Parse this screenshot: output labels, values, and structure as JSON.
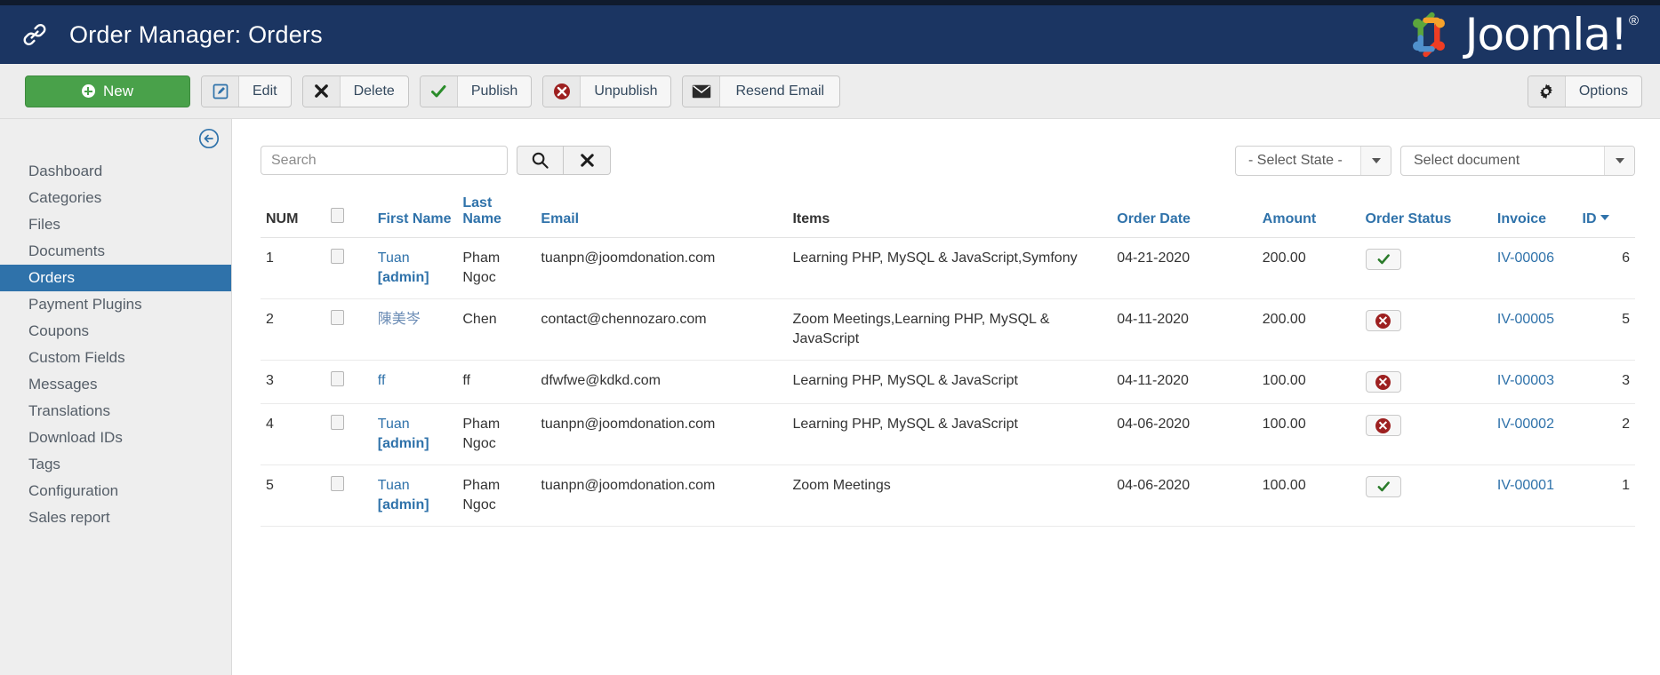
{
  "header": {
    "title": "Order Manager: Orders",
    "link_icon": "link-icon",
    "brand_name": "Joomla!",
    "brand_reg": "®",
    "bg_color": "#1b3562"
  },
  "toolbar": {
    "new_label": "New",
    "edit_label": "Edit",
    "delete_label": "Delete",
    "publish_label": "Publish",
    "unpublish_label": "Unpublish",
    "resend_label": "Resend Email",
    "options_label": "Options",
    "new_color": "#49a14a"
  },
  "sidebar": {
    "collapse_icon": "collapse-left-icon",
    "items": [
      {
        "label": "Dashboard",
        "active": false
      },
      {
        "label": "Categories",
        "active": false
      },
      {
        "label": "Files",
        "active": false
      },
      {
        "label": "Documents",
        "active": false
      },
      {
        "label": "Orders",
        "active": true
      },
      {
        "label": "Payment Plugins",
        "active": false
      },
      {
        "label": "Coupons",
        "active": false
      },
      {
        "label": "Custom Fields",
        "active": false
      },
      {
        "label": "Messages",
        "active": false
      },
      {
        "label": "Translations",
        "active": false
      },
      {
        "label": "Download IDs",
        "active": false
      },
      {
        "label": "Tags",
        "active": false
      },
      {
        "label": "Configuration",
        "active": false
      },
      {
        "label": "Sales report",
        "active": false
      }
    ],
    "active_color": "#2f72aa"
  },
  "filters": {
    "search_value": "",
    "search_placeholder": "Search",
    "search_button_icon": "search-icon",
    "clear_button_icon": "clear-x-icon",
    "state_select": "- Select State -",
    "document_select": "Select document"
  },
  "table": {
    "columns": [
      {
        "key": "num",
        "label": "NUM",
        "sortable": false
      },
      {
        "key": "check",
        "label": "",
        "sortable": false
      },
      {
        "key": "first_name",
        "label": "First Name",
        "sortable": true
      },
      {
        "key": "last_name",
        "label": "Last Name",
        "sortable": true
      },
      {
        "key": "email",
        "label": "Email",
        "sortable": true
      },
      {
        "key": "items",
        "label": "Items",
        "sortable": false
      },
      {
        "key": "order_date",
        "label": "Order Date",
        "sortable": true
      },
      {
        "key": "amount",
        "label": "Amount",
        "sortable": true
      },
      {
        "key": "order_status",
        "label": "Order Status",
        "sortable": true
      },
      {
        "key": "invoice",
        "label": "Invoice",
        "sortable": false
      },
      {
        "key": "id",
        "label": "ID",
        "sortable": true,
        "sort_active": true
      }
    ],
    "rows": [
      {
        "num": "1",
        "first_name": "Tuan",
        "first_name_tag": "[admin]",
        "last_name": "Pham Ngoc",
        "email": "tuanpn@joomdonation.com",
        "items": "Learning PHP, MySQL & JavaScript,Symfony",
        "order_date": "04-21-2020",
        "amount": "200.00",
        "order_status": "published",
        "invoice": "IV-00006",
        "id": "6"
      },
      {
        "num": "2",
        "first_name": "陳美岑",
        "first_name_tag": "",
        "last_name": "Chen",
        "email": "contact@chennozaro.com",
        "items": "Zoom Meetings,Learning PHP, MySQL & JavaScript",
        "order_date": "04-11-2020",
        "amount": "200.00",
        "order_status": "unpublished",
        "invoice": "IV-00005",
        "id": "5"
      },
      {
        "num": "3",
        "first_name": "ff",
        "first_name_tag": "",
        "last_name": "ff",
        "email": "dfwfwe@kdkd.com",
        "items": "Learning PHP, MySQL & JavaScript",
        "order_date": "04-11-2020",
        "amount": "100.00",
        "order_status": "unpublished",
        "invoice": "IV-00003",
        "id": "3"
      },
      {
        "num": "4",
        "first_name": "Tuan",
        "first_name_tag": "[admin]",
        "last_name": "Pham Ngoc",
        "email": "tuanpn@joomdonation.com",
        "items": "Learning PHP, MySQL & JavaScript",
        "order_date": "04-06-2020",
        "amount": "100.00",
        "order_status": "unpublished",
        "invoice": "IV-00002",
        "id": "2"
      },
      {
        "num": "5",
        "first_name": "Tuan",
        "first_name_tag": "[admin]",
        "last_name": "Pham Ngoc",
        "email": "tuanpn@joomdonation.com",
        "items": "Zoom Meetings",
        "order_date": "04-06-2020",
        "amount": "100.00",
        "order_status": "published",
        "invoice": "IV-00001",
        "id": "1"
      }
    ]
  },
  "colors": {
    "link": "#2f72aa",
    "status_published": "#2a7b2a",
    "status_unpublished": "#9d2020"
  }
}
